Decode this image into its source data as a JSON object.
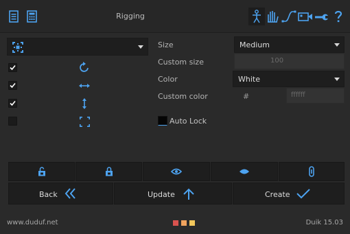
{
  "header": {
    "title": "Rigging",
    "icons": [
      "notes-icon",
      "calculator-icon",
      "person-icon",
      "hand-icon",
      "curve-icon",
      "camera-icon",
      "wrench-icon",
      "help-icon"
    ]
  },
  "controller_panel": {
    "shape_dropdown": {
      "icon": "controller-shape-icon"
    },
    "options": [
      {
        "checked": true,
        "icon": "rotation-icon"
      },
      {
        "checked": true,
        "icon": "horizontal-arrows-icon"
      },
      {
        "checked": true,
        "icon": "vertical-arrows-icon"
      },
      {
        "checked": false,
        "icon": "scale-corners-icon"
      }
    ]
  },
  "settings": {
    "size_label": "Size",
    "size_value": "Medium",
    "custom_size_label": "Custom size",
    "custom_size_value": "100",
    "color_label": "Color",
    "color_value": "White",
    "custom_color_label": "Custom color",
    "hash": "#",
    "custom_color_value": "ffffff",
    "auto_lock_label": "Auto Lock",
    "auto_lock_checked": false
  },
  "lock_row": {
    "icons": [
      "unlock-icon",
      "lock-icon",
      "show-icon",
      "hide-icon",
      "link-icon"
    ]
  },
  "actions": {
    "back_label": "Back",
    "update_label": "Update",
    "create_label": "Create"
  },
  "footer": {
    "website": "www.duduf.net",
    "version": "Duik 15.03",
    "swatches": [
      "#d9534f",
      "#f0a35e",
      "#f2c75c"
    ]
  },
  "colors": {
    "accent": "#4da3f0",
    "background": "#2a2a2a",
    "button": "#1e1e1e"
  }
}
